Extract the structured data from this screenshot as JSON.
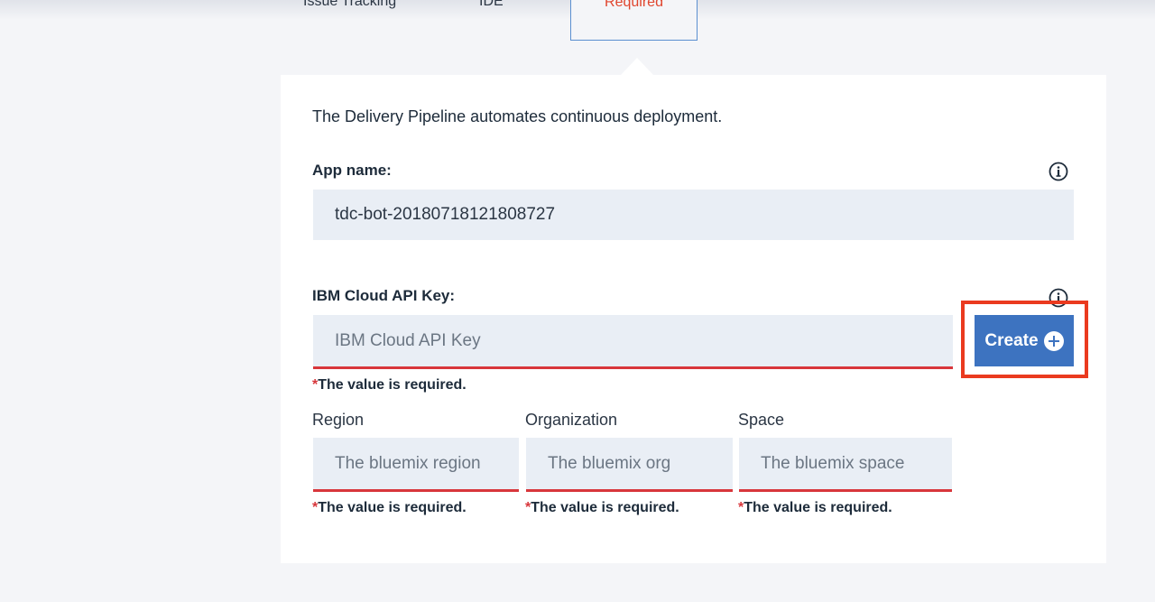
{
  "tabs": {
    "issue_tracking": "Issue Tracking",
    "ide": "IDE",
    "required": "Required"
  },
  "panel": {
    "description": "The Delivery Pipeline automates continuous deployment.",
    "app_name": {
      "label": "App name:",
      "value": "tdc-bot-20180718121808727",
      "info_icon": "info-icon"
    },
    "api_key": {
      "label": "IBM Cloud API Key:",
      "placeholder": "IBM Cloud API Key",
      "value": "",
      "error": "The value is required.",
      "info_icon": "info-icon",
      "create_label": "Create",
      "create_icon": "plus-circle-icon"
    },
    "region": {
      "label": "Region",
      "placeholder": "The bluemix region",
      "error": "The value is required."
    },
    "organization": {
      "label": "Organization",
      "placeholder": "The bluemix org",
      "error": "The value is required."
    },
    "space": {
      "label": "Space",
      "placeholder": "The bluemix space",
      "error": "The value is required."
    },
    "required_marker": "*"
  },
  "colors": {
    "accent_blue": "#3d73c0",
    "error_red": "#d8363b",
    "highlight": "#ea3a1f",
    "input_bg": "#e9eef5"
  }
}
